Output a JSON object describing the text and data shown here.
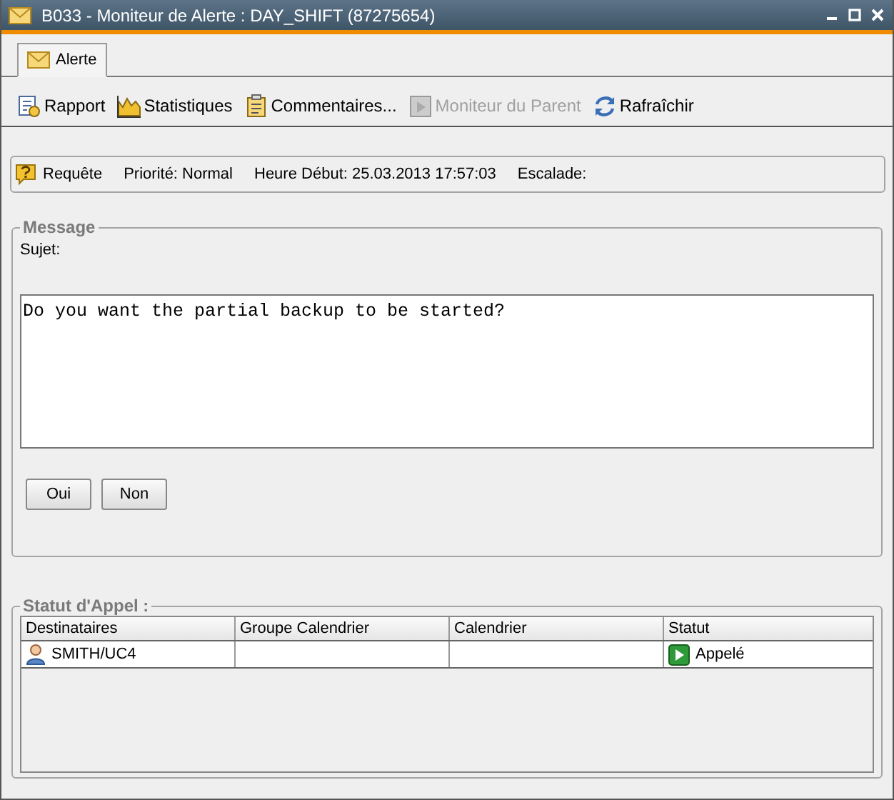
{
  "window": {
    "title": "B033 - Moniteur de Alerte : DAY_SHIFT (87275654)"
  },
  "tabs": [
    {
      "label": "Alerte",
      "selected": true
    }
  ],
  "toolbar": [
    {
      "label": "Rapport",
      "disabled": false
    },
    {
      "label": "Statistiques",
      "disabled": false
    },
    {
      "label": "Commentaires...",
      "disabled": false
    },
    {
      "label": "Moniteur du Parent",
      "disabled": true
    },
    {
      "label": "Rafraîchir",
      "disabled": false
    }
  ],
  "info": {
    "type": "Requête",
    "fields": [
      "Priorité: Normal",
      "Heure Début: 25.03.2013 17:57:03",
      "Escalade:"
    ]
  },
  "message": {
    "legend": "Message",
    "subject_label": "Sujet:",
    "body": "Do you want the partial backup to be started?",
    "buttons": [
      "Oui",
      "Non"
    ]
  },
  "call_status": {
    "legend": "Statut d'Appel :",
    "columns": [
      "Destinataires",
      "Groupe Calendrier",
      "Calendrier",
      "Statut"
    ],
    "rows": [
      {
        "recipient": "SMITH/UC4",
        "status": "Appelé"
      }
    ]
  }
}
